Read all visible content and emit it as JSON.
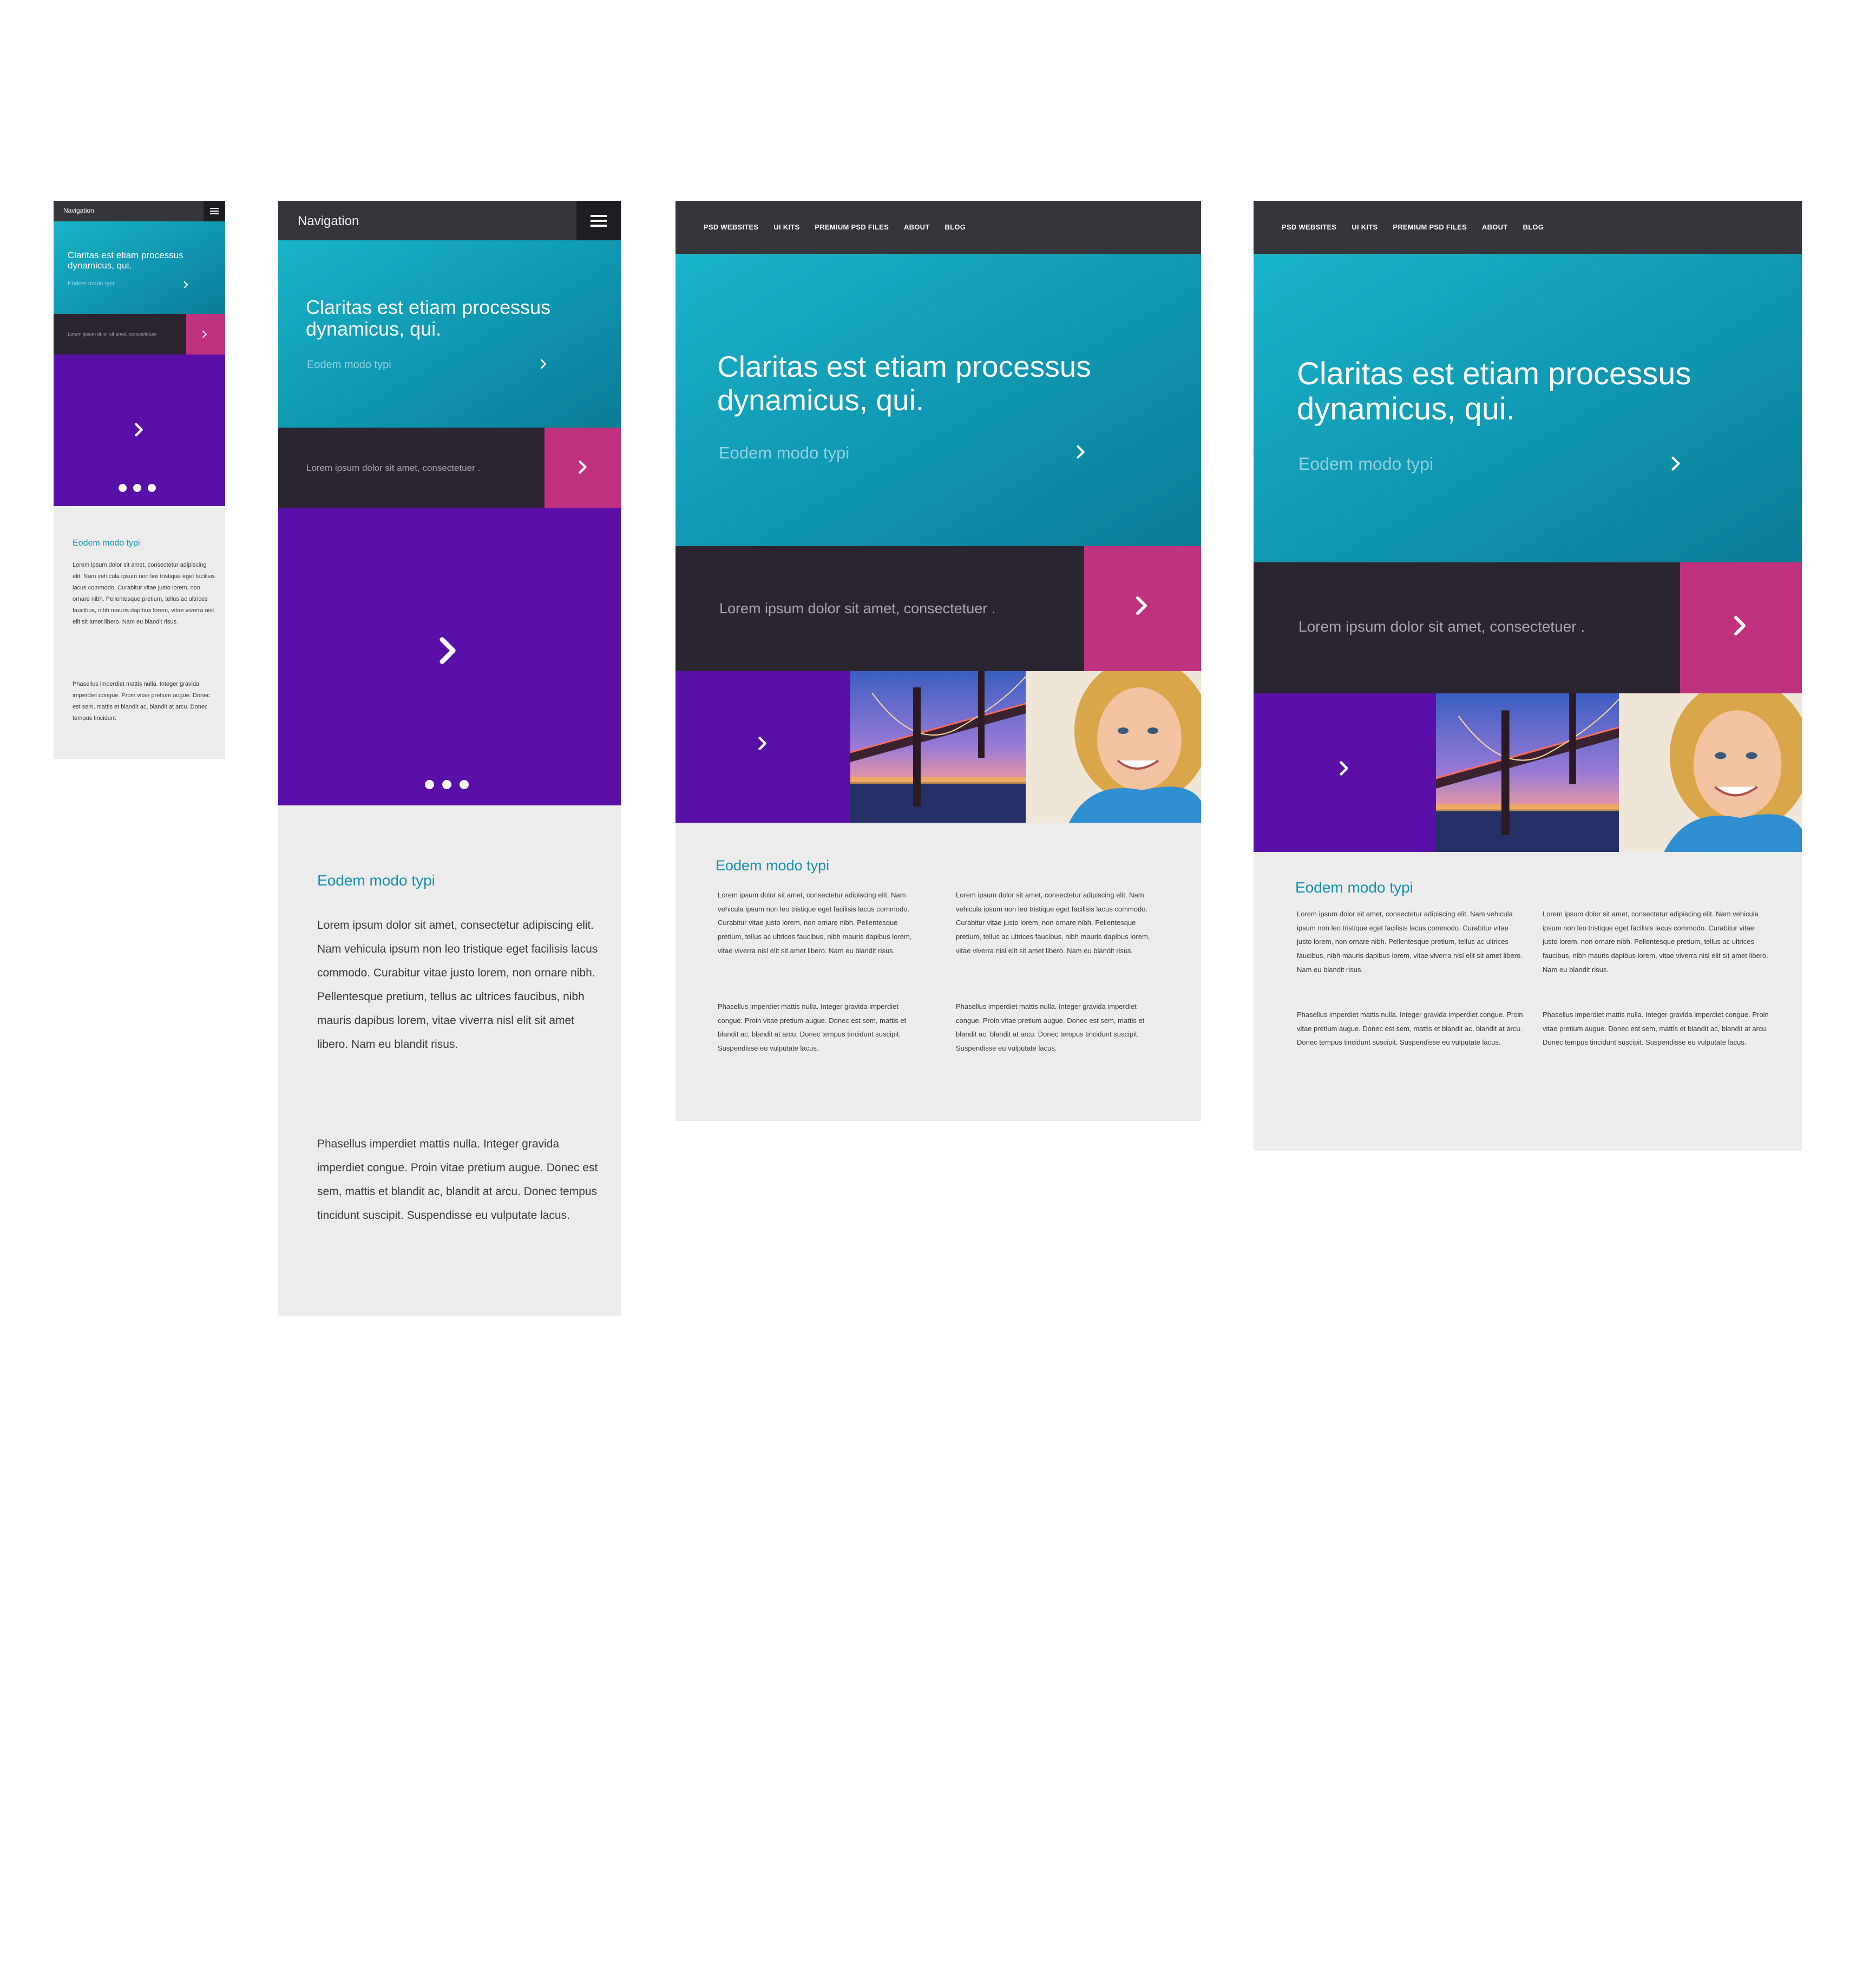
{
  "colors": {
    "topbar": "#35363b",
    "hero_gradient_start": "#19b4c9",
    "hero_gradient_end": "#0a7c97",
    "dark_band": "#2b2531",
    "pink": "#c0327f",
    "purple": "#5a0fa8",
    "content_bg": "#ececec",
    "heading_teal": "#1293ab"
  },
  "icons": {
    "menu": "hamburger-icon",
    "arrow": "chevron-right-icon",
    "slider": "pagination-dots"
  },
  "mobile": {
    "nav_title": "Navigation",
    "hero_title": "Claritas est etiam processus dynamicus, qui.",
    "hero_sub": "Eodem modo typi",
    "band_text": "Lorem ipsum dolor sit amet, consectetuer",
    "section_heading": "Eodem modo typi",
    "para1": "Lorem ipsum dolor sit amet, consectetur adipiscing elit. Nam vehicula ipsum non leo tristique eget facilisis lacus commodo. Curabitur vitae justo lorem, non ornare nibh. Pellentesque pretium, tellus ac ultrices faucibus, nibh mauris dapibus lorem, vitae viverra nisl elit sit amet libero. Nam eu blandit risus.",
    "para2": "Phasellus imperdiet mattis nulla. Integer gravida imperdiet congue. Proin vitae pretium augue. Donec est sem, mattis et blandit ac, blandit at arcu. Donec tempus tincidunt"
  },
  "tablet": {
    "nav_title": "Navigation",
    "hero_title": "Claritas est etiam processus dynamicus, qui.",
    "hero_sub": "Eodem modo typi",
    "band_text": "Lorem ipsum dolor sit amet, consectetuer .",
    "section_heading": "Eodem modo typi",
    "para1": "Lorem ipsum dolor sit amet, consectetur adipiscing elit. Nam vehicula ipsum non leo tristique eget facilisis lacus commodo. Curabitur vitae justo lorem, non ornare nibh. Pellentesque pretium, tellus ac ultrices faucibus, nibh mauris dapibus lorem, vitae viverra nisl elit sit amet libero. Nam eu blandit risus.",
    "para2": "Phasellus imperdiet mattis nulla. Integer gravida imperdiet congue. Proin vitae pretium augue. Donec est sem, mattis et blandit ac, blandit at arcu. Donec tempus tincidunt suscipit. Suspendisse eu vulputate lacus."
  },
  "desktop": {
    "nav_links": [
      "PSD WEBSITES",
      "UI KITS",
      "PREMIUM PSD FILES",
      "ABOUT",
      "BLOG"
    ],
    "hero_title": "Claritas est etiam processus dynamicus, qui.",
    "hero_sub": "Eodem modo typi",
    "band_text": "Lorem ipsum dolor sit amet, consectetuer .",
    "section_heading": "Eodem modo typi",
    "col1_para1": "Lorem ipsum dolor sit amet, consectetur adipiscing elit. Nam vehicula ipsum non leo tristique eget facilisis lacus commodo. Curabitur vitae justo lorem, non ornare nibh. Pellentesque pretium, tellus ac ultrices faucibus, nibh mauris dapibus lorem, vitae viverra nisl elit sit amet libero. Nam eu blandit risus.",
    "col1_para2": "Phasellus imperdiet mattis nulla. Integer gravida imperdiet congue. Proin vitae pretium augue. Donec est sem, mattis et blandit ac, blandit at arcu. Donec tempus tincidunt suscipit. Suspendisse eu vulputate lacus.",
    "col2_para1": "Lorem ipsum dolor sit amet, consectetur adipiscing elit. Nam vehicula ipsum non leo tristique eget facilisis lacus commodo. Curabitur vitae justo lorem, non ornare nibh. Pellentesque pretium, tellus ac ultrices faucibus, nibh mauris dapibus lorem, vitae viverra nisl elit sit amet libero. Nam eu blandit risus.",
    "col2_para2": "Phasellus imperdiet mattis nulla. Integer gravida imperdiet congue. Proin vitae pretium augue. Donec est sem, mattis et blandit ac, blandit at arcu. Donec tempus tincidunt suscipit. Suspendisse eu vulputate lacus."
  },
  "wide": {
    "nav_links": [
      "PSD WEBSITES",
      "UI KITS",
      "PREMIUM PSD FILES",
      "ABOUT",
      "BLOG"
    ],
    "hero_title": "Claritas est etiam processus dynamicus, qui.",
    "hero_sub": "Eodem modo typi",
    "band_text": "Lorem ipsum dolor sit amet, consectetuer .",
    "section_heading": "Eodem modo typi",
    "col1_para1": "Lorem ipsum dolor sit amet, consectetur adipiscing elit. Nam vehicula ipsum non leo tristique eget facilisis lacus commodo. Curabitur vitae justo lorem, non ornare nibh. Pellentesque pretium, tellus ac ultrices faucibus, nibh mauris dapibus lorem, vitae viverra nisl elit sit amet libero. Nam eu blandit risus.",
    "col1_para2": "Phasellus imperdiet mattis nulla. Integer gravida imperdiet congue. Proin vitae pretium augue. Donec est sem, mattis et blandit ac, blandit at arcu. Donec tempus tincidunt suscipit. Suspendisse eu vulputate lacus.",
    "col2_para1": "Lorem ipsum dolor sit amet, consectetur adipiscing elit. Nam vehicula ipsum non leo tristique eget facilisis lacus commodo. Curabitur vitae justo lorem, non ornare nibh. Pellentesque pretium, tellus ac ultrices faucibus, nibh mauris dapibus lorem, vitae viverra nisl elit sit amet libero. Nam eu blandit risus.",
    "col2_para2": "Phasellus imperdiet mattis nulla. Integer gravida imperdiet congue. Proin vitae pretium augue. Donec est sem, mattis et blandit ac, blandit at arcu. Donec tempus tincidunt suscipit. Suspendisse eu vulputate lacus."
  }
}
